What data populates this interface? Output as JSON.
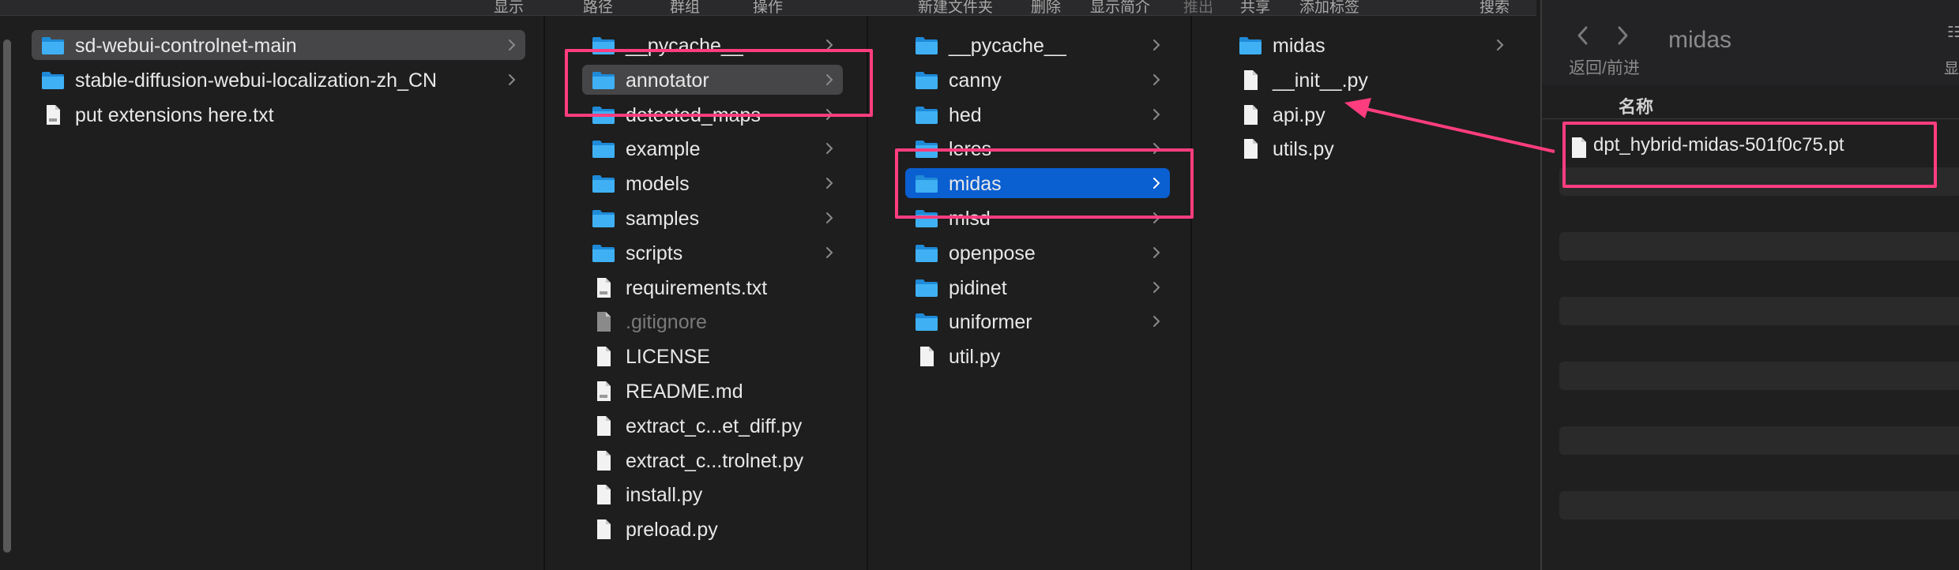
{
  "toolbar": {
    "items": [
      "显示",
      "路径",
      "群组",
      "操作",
      "新建文件夹",
      "删除",
      "显示简介",
      "推出",
      "共享",
      "添加标签",
      "搜索"
    ]
  },
  "columns": [
    {
      "rows": [
        {
          "name": "sd-webui-controlnet-main",
          "icon": "folder-icon",
          "chevron": true,
          "state": "selected-gray"
        },
        {
          "name": "stable-diffusion-webui-localization-zh_CN",
          "icon": "folder-icon",
          "chevron": true
        },
        {
          "name": "put extensions here.txt",
          "icon": "text-file-icon",
          "chevron": false
        }
      ]
    },
    {
      "rows": [
        {
          "name": "__pycache__",
          "icon": "folder-icon",
          "chevron": true
        },
        {
          "name": "annotator",
          "icon": "folder-icon",
          "chevron": true,
          "state": "selected-gray"
        },
        {
          "name": "detected_maps",
          "icon": "folder-icon",
          "chevron": true
        },
        {
          "name": "example",
          "icon": "folder-icon",
          "chevron": true
        },
        {
          "name": "models",
          "icon": "folder-icon",
          "chevron": true
        },
        {
          "name": "samples",
          "icon": "folder-icon",
          "chevron": true
        },
        {
          "name": "scripts",
          "icon": "folder-icon",
          "chevron": true
        },
        {
          "name": "requirements.txt",
          "icon": "text-file-icon",
          "chevron": false
        },
        {
          "name": ".gitignore",
          "icon": "hidden-file-icon",
          "chevron": false,
          "state": "dim"
        },
        {
          "name": "LICENSE",
          "icon": "file-icon",
          "chevron": false
        },
        {
          "name": "README.md",
          "icon": "markdown-file-icon",
          "chevron": false
        },
        {
          "name": "extract_c...et_diff.py",
          "icon": "file-icon",
          "chevron": false
        },
        {
          "name": "extract_c...trolnet.py",
          "icon": "file-icon",
          "chevron": false
        },
        {
          "name": "install.py",
          "icon": "file-icon",
          "chevron": false
        },
        {
          "name": "preload.py",
          "icon": "file-icon",
          "chevron": false
        }
      ]
    },
    {
      "rows": [
        {
          "name": "__pycache__",
          "icon": "folder-icon",
          "chevron": true
        },
        {
          "name": "canny",
          "icon": "folder-icon",
          "chevron": true
        },
        {
          "name": "hed",
          "icon": "folder-icon",
          "chevron": true
        },
        {
          "name": "leres",
          "icon": "folder-icon",
          "chevron": true
        },
        {
          "name": "midas",
          "icon": "folder-icon",
          "chevron": true,
          "state": "selected-blue"
        },
        {
          "name": "mlsd",
          "icon": "folder-icon",
          "chevron": true
        },
        {
          "name": "openpose",
          "icon": "folder-icon",
          "chevron": true
        },
        {
          "name": "pidinet",
          "icon": "folder-icon",
          "chevron": true
        },
        {
          "name": "uniformer",
          "icon": "folder-icon",
          "chevron": true
        },
        {
          "name": "util.py",
          "icon": "file-icon",
          "chevron": false
        }
      ]
    },
    {
      "rows": [
        {
          "name": "midas",
          "icon": "folder-icon",
          "chevron": true
        },
        {
          "name": "__init__.py",
          "icon": "file-icon",
          "chevron": false
        },
        {
          "name": "api.py",
          "icon": "file-icon",
          "chevron": false
        },
        {
          "name": "utils.py",
          "icon": "file-icon",
          "chevron": false
        }
      ]
    }
  ],
  "info_window": {
    "title": "midas",
    "nav_label": "返回/前进",
    "column_header": "名称",
    "file": "dpt_hybrid-midas-501f0c75.pt",
    "edge_glyph_top": "☷",
    "edge_glyph_bottom": "显"
  },
  "colors": {
    "highlight": "#ff3d7f",
    "folder": "#2fa7f0",
    "selection_blue": "#0a5fd1",
    "selection_gray": "#464648"
  }
}
